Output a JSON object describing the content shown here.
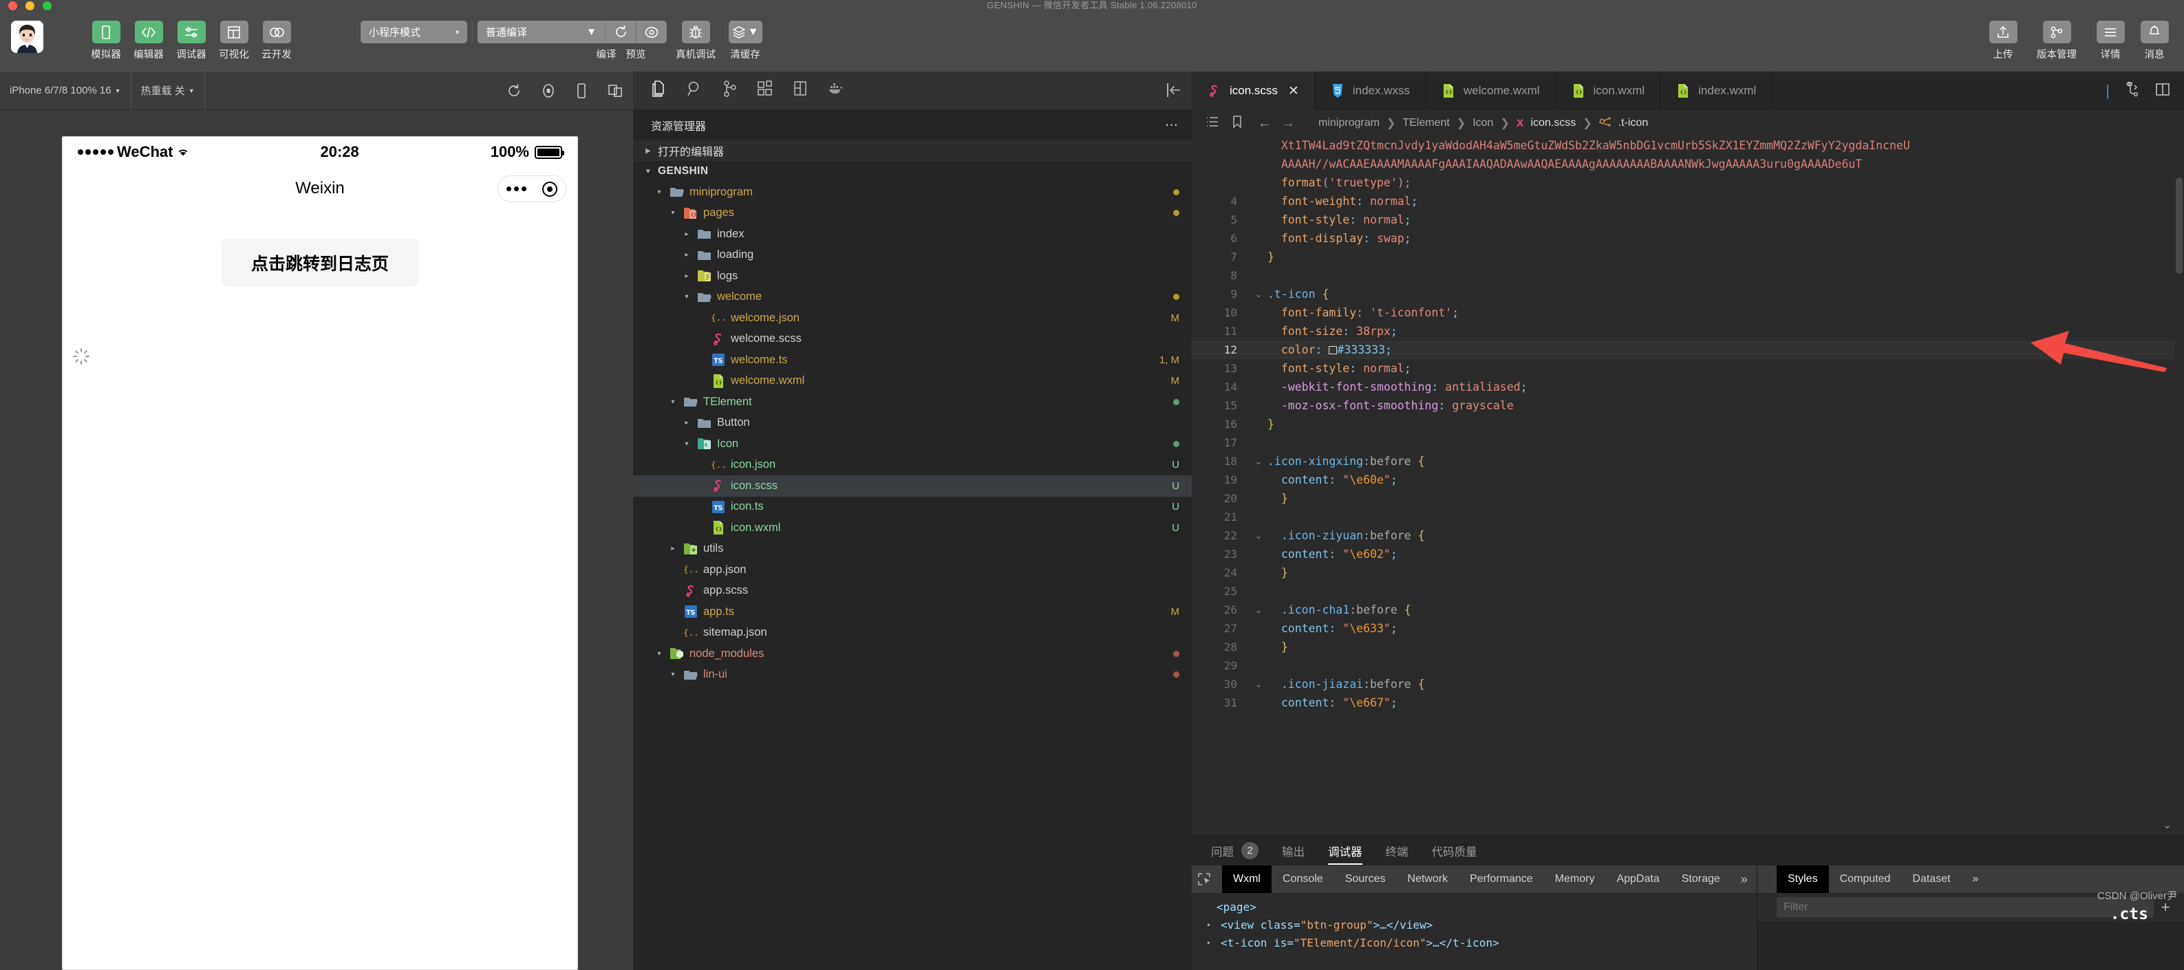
{
  "window": {
    "title": "GENSHIN — 微信开发者工具 Stable 1.06.2208010",
    "traffic": [
      "#ff5f57",
      "#febc2e",
      "#28c840"
    ]
  },
  "toolbar": {
    "left_buttons": [
      {
        "label": "模拟器",
        "icon": "phone-icon",
        "active": true
      },
      {
        "label": "编辑器",
        "icon": "code-icon",
        "active": true
      },
      {
        "label": "调试器",
        "icon": "sliders-icon",
        "active": true
      },
      {
        "label": "可视化",
        "icon": "layout-icon",
        "active": false
      },
      {
        "label": "云开发",
        "icon": "cloud-icon",
        "active": false
      }
    ],
    "mode_select": "小程序模式",
    "compile_select": "普通编译",
    "compile_label": "编译",
    "preview_label": "预览",
    "realdebug_label": "真机调试",
    "clearcache_label": "清缓存",
    "right_buttons": [
      {
        "label": "上传",
        "icon": "upload-icon"
      },
      {
        "label": "版本管理",
        "icon": "branch-icon"
      },
      {
        "label": "详情",
        "icon": "hamburger-icon"
      },
      {
        "label": "消息",
        "icon": "bell-icon"
      }
    ]
  },
  "simulator": {
    "device": "iPhone 6/7/8 100% 16",
    "hotreload": "热重载 关",
    "icons": [
      "refresh-icon",
      "record-icon",
      "device-icon",
      "multiscreen-icon"
    ],
    "phone": {
      "carrier": "WeChat",
      "time": "20:28",
      "battery_percent": "100%",
      "nav_title": "Weixin",
      "button_label": "点击跳转到日志页"
    }
  },
  "explorer": {
    "activity_icons": [
      "files-icon",
      "search-icon",
      "source-control-icon",
      "extensions-icon",
      "debug-icon",
      "docker-icon"
    ],
    "collapse_icon": "collapse-sidebar-icon",
    "title": "资源管理器",
    "more_icon": "ellipsis-icon",
    "open_editors": "打开的编辑器",
    "root": "GENSHIN",
    "tree": [
      {
        "name": "miniprogram",
        "indent": 1,
        "type": "folder-open",
        "color": "#cda84a",
        "twisty": "▾",
        "dot": "#b59a2f",
        "badge": ""
      },
      {
        "name": "pages",
        "indent": 2,
        "type": "folder-pages",
        "color": "#cda84a",
        "twisty": "▾",
        "dot": "#b59a2f",
        "badge": ""
      },
      {
        "name": "index",
        "indent": 3,
        "type": "folder",
        "color": "#cfcfcf",
        "twisty": "▸",
        "dot": "",
        "badge": ""
      },
      {
        "name": "loading",
        "indent": 3,
        "type": "folder",
        "color": "#cfcfcf",
        "twisty": "▸",
        "dot": "",
        "badge": ""
      },
      {
        "name": "logs",
        "indent": 3,
        "type": "folder-logs",
        "color": "#cfcfcf",
        "twisty": "▸",
        "dot": "",
        "badge": ""
      },
      {
        "name": "welcome",
        "indent": 3,
        "type": "folder-open",
        "color": "#cda84a",
        "twisty": "▾",
        "dot": "#b59a2f",
        "badge": ""
      },
      {
        "name": "welcome.json",
        "indent": 4,
        "type": "json",
        "color": "#cda84a",
        "twisty": "",
        "dot": "",
        "badge": "M",
        "badge_color": "#cda84a"
      },
      {
        "name": "welcome.scss",
        "indent": 4,
        "type": "scss",
        "color": "#cfcfcf",
        "twisty": "",
        "dot": "",
        "badge": ""
      },
      {
        "name": "welcome.ts",
        "indent": 4,
        "type": "ts",
        "color": "#cda84a",
        "twisty": "",
        "dot": "",
        "badge": "1, M",
        "badge_color": "#cda84a"
      },
      {
        "name": "welcome.wxml",
        "indent": 4,
        "type": "wxml",
        "color": "#cda84a",
        "twisty": "",
        "dot": "",
        "badge": "M",
        "badge_color": "#cda84a"
      },
      {
        "name": "TElement",
        "indent": 2,
        "type": "folder-open",
        "color": "#8ed6a0",
        "twisty": "▾",
        "dot": "#5fa06f",
        "badge": ""
      },
      {
        "name": "Button",
        "indent": 3,
        "type": "folder",
        "color": "#cfcfcf",
        "twisty": "▸",
        "dot": "",
        "badge": ""
      },
      {
        "name": "Icon",
        "indent": 3,
        "type": "folder-icon",
        "color": "#8ed6a0",
        "twisty": "▾",
        "dot": "#5fa06f",
        "badge": ""
      },
      {
        "name": "icon.json",
        "indent": 4,
        "type": "json",
        "color": "#8ed6a0",
        "twisty": "",
        "dot": "",
        "badge": "U",
        "badge_color": "#8ed6a0"
      },
      {
        "name": "icon.scss",
        "indent": 4,
        "type": "scss",
        "color": "#8ed6a0",
        "twisty": "",
        "dot": "",
        "badge": "U",
        "badge_color": "#8ed6a0",
        "selected": true
      },
      {
        "name": "icon.ts",
        "indent": 4,
        "type": "ts",
        "color": "#8ed6a0",
        "twisty": "",
        "dot": "",
        "badge": "U",
        "badge_color": "#8ed6a0"
      },
      {
        "name": "icon.wxml",
        "indent": 4,
        "type": "wxml",
        "color": "#8ed6a0",
        "twisty": "",
        "dot": "",
        "badge": "U",
        "badge_color": "#8ed6a0"
      },
      {
        "name": "utils",
        "indent": 2,
        "type": "folder-utils",
        "color": "#cfcfcf",
        "twisty": "▸",
        "dot": "",
        "badge": ""
      },
      {
        "name": "app.json",
        "indent": 2,
        "type": "json",
        "color": "#cfcfcf",
        "twisty": "",
        "dot": "",
        "badge": ""
      },
      {
        "name": "app.scss",
        "indent": 2,
        "type": "scss",
        "color": "#cfcfcf",
        "twisty": "",
        "dot": "",
        "badge": ""
      },
      {
        "name": "app.ts",
        "indent": 2,
        "type": "ts",
        "color": "#cda84a",
        "twisty": "",
        "dot": "",
        "badge": "M",
        "badge_color": "#cda84a"
      },
      {
        "name": "sitemap.json",
        "indent": 2,
        "type": "json",
        "color": "#cfcfcf",
        "twisty": "",
        "dot": "",
        "badge": ""
      },
      {
        "name": "node_modules",
        "indent": 1,
        "type": "folder-node",
        "color": "#d98a7a",
        "twisty": "▾",
        "dot": "#a9574a",
        "badge": ""
      },
      {
        "name": "lin-ui",
        "indent": 2,
        "type": "folder-open",
        "color": "#d98a7a",
        "twisty": "▾",
        "dot": "#a9574a",
        "badge": ""
      }
    ]
  },
  "editor": {
    "tabs": [
      {
        "label": "icon.scss",
        "icon": "scss-icon",
        "active": true,
        "closable": true
      },
      {
        "label": "index.wxss",
        "icon": "wxss-icon",
        "active": false
      },
      {
        "label": "welcome.wxml",
        "icon": "wxml-icon",
        "active": false
      },
      {
        "label": "icon.wxml",
        "icon": "wxml-icon",
        "active": false
      },
      {
        "label": "index.wxml",
        "icon": "wxml-icon",
        "active": false
      }
    ],
    "tab_actions": [
      "split-icon",
      "layout-icon"
    ],
    "breadcrumb_icons": [
      "outline-icon",
      "bookmark-icon",
      "back-arrow-icon",
      "forward-arrow-icon"
    ],
    "breadcrumb": [
      "miniprogram",
      "TElement",
      "Icon",
      "icon.scss",
      ".t-icon"
    ],
    "lines": [
      {
        "num": "",
        "fold": "",
        "parts": [
          {
            "t": "  Xt1TW4Lad9tZQtmcnJvdy1yaWdodAH4aW5meGtuZWdSb2ZkaW5nbDG1vcmUrb5SkZX1EYZmmMQ2ZzWFyY2ygdaIncneU",
            "c": "k-b64"
          }
        ]
      },
      {
        "num": "",
        "fold": "",
        "parts": [
          {
            "t": "  AAAAH//wACAAEAAAAMAAAAFgAAAIAAQADAAwAAQAEAAAAgAAAAAAAABAAAANWkJwgAAAAA3uru0gAAAADe6uT",
            "c": "k-b64"
          }
        ]
      },
      {
        "num": "",
        "fold": "",
        "parts": [
          {
            "t": "  ",
            "c": ""
          },
          {
            "t": "format",
            "c": "k-fn"
          },
          {
            "t": "(",
            "c": "k-quote"
          },
          {
            "t": "'truetype'",
            "c": "k-str"
          },
          {
            "t": ")",
            "c": "k-quote"
          },
          {
            "t": ";",
            "c": "k-quote"
          }
        ]
      },
      {
        "num": "4",
        "fold": "",
        "parts": [
          {
            "t": "  ",
            "c": ""
          },
          {
            "t": "font-weight",
            "c": "k-prop"
          },
          {
            "t": ":",
            "c": "k-hex"
          },
          {
            "t": " normal",
            "c": "k-val"
          },
          {
            "t": ";",
            "c": "k-hex"
          }
        ]
      },
      {
        "num": "5",
        "fold": "",
        "parts": [
          {
            "t": "  ",
            "c": ""
          },
          {
            "t": "font-style",
            "c": "k-prop"
          },
          {
            "t": ":",
            "c": "k-hex"
          },
          {
            "t": " normal",
            "c": "k-val"
          },
          {
            "t": ";",
            "c": "k-hex"
          }
        ]
      },
      {
        "num": "6",
        "fold": "",
        "parts": [
          {
            "t": "  ",
            "c": ""
          },
          {
            "t": "font-display",
            "c": "k-prop"
          },
          {
            "t": ":",
            "c": "k-hex"
          },
          {
            "t": " swap",
            "c": "k-val"
          },
          {
            "t": ";",
            "c": "k-hex"
          }
        ]
      },
      {
        "num": "7",
        "fold": "",
        "parts": [
          {
            "t": "}",
            "c": "k-punc"
          }
        ]
      },
      {
        "num": "8",
        "fold": "",
        "parts": []
      },
      {
        "num": "9",
        "fold": "⌄",
        "parts": [
          {
            "t": ".t-icon",
            "c": "k-sel"
          },
          {
            "t": " ",
            "c": ""
          },
          {
            "t": "{",
            "c": "k-punc"
          }
        ]
      },
      {
        "num": "10",
        "fold": "",
        "parts": [
          {
            "t": "  ",
            "c": ""
          },
          {
            "t": "font-family",
            "c": "k-prop"
          },
          {
            "t": ": ",
            "c": "k-hex"
          },
          {
            "t": "'t-iconfont'",
            "c": "k-str"
          },
          {
            "t": ";",
            "c": "k-hex"
          }
        ]
      },
      {
        "num": "11",
        "fold": "",
        "parts": [
          {
            "t": "  ",
            "c": ""
          },
          {
            "t": "font-size",
            "c": "k-prop"
          },
          {
            "t": ": ",
            "c": "k-hex"
          },
          {
            "t": "38",
            "c": "k-num"
          },
          {
            "t": "rpx",
            "c": "k-val"
          },
          {
            "t": ";",
            "c": "k-hex"
          }
        ]
      },
      {
        "num": "12",
        "fold": "",
        "highlight": true,
        "swatch": "#333333",
        "parts": [
          {
            "t": "  ",
            "c": ""
          },
          {
            "t": "color",
            "c": "k-prop"
          },
          {
            "t": ": ",
            "c": "k-hex"
          },
          {
            "t": "SWATCH",
            "c": ""
          },
          {
            "t": "#333333",
            "c": "k-hex"
          },
          {
            "t": ";",
            "c": "k-hex"
          }
        ]
      },
      {
        "num": "13",
        "fold": "",
        "parts": [
          {
            "t": "  ",
            "c": ""
          },
          {
            "t": "font-style",
            "c": "k-prop"
          },
          {
            "t": ":",
            "c": "k-hex"
          },
          {
            "t": " normal",
            "c": "k-val"
          },
          {
            "t": ";",
            "c": "k-hex"
          }
        ]
      },
      {
        "num": "14",
        "fold": "",
        "parts": [
          {
            "t": "  ",
            "c": ""
          },
          {
            "t": "-webkit-font-smoothing",
            "c": "k-vendor"
          },
          {
            "t": ":",
            "c": "k-hex"
          },
          {
            "t": " antialiased",
            "c": "k-val"
          },
          {
            "t": ";",
            "c": "k-hex"
          }
        ]
      },
      {
        "num": "15",
        "fold": "",
        "parts": [
          {
            "t": "  ",
            "c": ""
          },
          {
            "t": "-moz-osx-font-smoothing",
            "c": "k-vendor"
          },
          {
            "t": ":",
            "c": "k-hex"
          },
          {
            "t": " grayscale",
            "c": "k-val"
          }
        ]
      },
      {
        "num": "16",
        "fold": "",
        "parts": [
          {
            "t": "}",
            "c": "k-punc"
          }
        ]
      },
      {
        "num": "17",
        "fold": "",
        "parts": []
      },
      {
        "num": "18",
        "fold": "⌄",
        "parts": [
          {
            "t": ".icon-xingxing",
            "c": "k-sel"
          },
          {
            "t": ":before",
            "c": "k-pseudo"
          },
          {
            "t": " ",
            "c": ""
          },
          {
            "t": "{",
            "c": "k-punc"
          }
        ]
      },
      {
        "num": "19",
        "fold": "",
        "parts": [
          {
            "t": "  ",
            "c": ""
          },
          {
            "t": "content",
            "c": "k-hex"
          },
          {
            "t": ": ",
            "c": "k-hex"
          },
          {
            "t": "\"",
            "c": "k-val"
          },
          {
            "t": "\\e60e",
            "c": "k-esc"
          },
          {
            "t": "\"",
            "c": "k-val"
          },
          {
            "t": ";",
            "c": "k-hex"
          }
        ]
      },
      {
        "num": "20",
        "fold": "",
        "parts": [
          {
            "t": "  }",
            "c": "k-punc"
          }
        ]
      },
      {
        "num": "21",
        "fold": "",
        "parts": []
      },
      {
        "num": "22",
        "fold": "⌄",
        "parts": [
          {
            "t": "  .icon-ziyuan",
            "c": "k-sel"
          },
          {
            "t": ":before",
            "c": "k-pseudo"
          },
          {
            "t": " ",
            "c": ""
          },
          {
            "t": "{",
            "c": "k-punc"
          }
        ]
      },
      {
        "num": "23",
        "fold": "",
        "parts": [
          {
            "t": "  ",
            "c": ""
          },
          {
            "t": "content",
            "c": "k-hex"
          },
          {
            "t": ": ",
            "c": "k-hex"
          },
          {
            "t": "\"",
            "c": "k-val"
          },
          {
            "t": "\\e602",
            "c": "k-esc"
          },
          {
            "t": "\"",
            "c": "k-val"
          },
          {
            "t": ";",
            "c": "k-hex"
          }
        ]
      },
      {
        "num": "24",
        "fold": "",
        "parts": [
          {
            "t": "  }",
            "c": "k-punc"
          }
        ]
      },
      {
        "num": "25",
        "fold": "",
        "parts": []
      },
      {
        "num": "26",
        "fold": "⌄",
        "parts": [
          {
            "t": "  .icon-cha1",
            "c": "k-sel"
          },
          {
            "t": ":before",
            "c": "k-pseudo"
          },
          {
            "t": " ",
            "c": ""
          },
          {
            "t": "{",
            "c": "k-punc"
          }
        ]
      },
      {
        "num": "27",
        "fold": "",
        "parts": [
          {
            "t": "  ",
            "c": ""
          },
          {
            "t": "content",
            "c": "k-hex"
          },
          {
            "t": ": ",
            "c": "k-hex"
          },
          {
            "t": "\"",
            "c": "k-val"
          },
          {
            "t": "\\e633",
            "c": "k-esc"
          },
          {
            "t": "\"",
            "c": "k-val"
          },
          {
            "t": ";",
            "c": "k-hex"
          }
        ]
      },
      {
        "num": "28",
        "fold": "",
        "parts": [
          {
            "t": "  }",
            "c": "k-punc"
          }
        ]
      },
      {
        "num": "29",
        "fold": "",
        "parts": []
      },
      {
        "num": "30",
        "fold": "⌄",
        "parts": [
          {
            "t": "  .icon-jiazai",
            "c": "k-sel"
          },
          {
            "t": ":before",
            "c": "k-pseudo"
          },
          {
            "t": " ",
            "c": ""
          },
          {
            "t": "{",
            "c": "k-punc"
          }
        ]
      },
      {
        "num": "31",
        "fold": "",
        "parts": [
          {
            "t": "  ",
            "c": ""
          },
          {
            "t": "content",
            "c": "k-hex"
          },
          {
            "t": ": ",
            "c": "k-hex"
          },
          {
            "t": "\"",
            "c": "k-val"
          },
          {
            "t": "\\e667",
            "c": "k-esc"
          },
          {
            "t": "\"",
            "c": "k-val"
          },
          {
            "t": ";",
            "c": "k-hex"
          }
        ]
      }
    ],
    "annotation_arrow_color": "#f04a42"
  },
  "bottom": {
    "tabs": [
      {
        "label": "问题",
        "badge": "2",
        "active": false
      },
      {
        "label": "输出",
        "badge": "",
        "active": false
      },
      {
        "label": "调试器",
        "badge": "",
        "active": true
      },
      {
        "label": "终端",
        "badge": "",
        "active": false
      },
      {
        "label": "代码质量",
        "badge": "",
        "active": false
      }
    ],
    "devtools": {
      "inspect_icon": "inspect-icon",
      "tabs": [
        "Wxml",
        "Console",
        "Sources",
        "Network",
        "Performance",
        "Memory",
        "AppData",
        "Storage"
      ],
      "active_tab": "Wxml",
      "overflow": "»",
      "settings_icon": "gear-icon",
      "dom": [
        {
          "indent": 0,
          "twisty": "",
          "text": "<page>"
        },
        {
          "indent": 1,
          "twisty": "▸",
          "pre": "<view class=",
          "attr": "\"btn-group\"",
          "post": ">…</view>"
        },
        {
          "indent": 1,
          "twisty": "▸",
          "pre": "<t-icon is=",
          "attr": "\"TElement/Icon/icon\"",
          "post": ">…</t-icon>"
        }
      ],
      "side_tabs": [
        "Styles",
        "Computed",
        "Dataset"
      ],
      "side_active": "Styles",
      "side_overflow": "»",
      "filter_placeholder": "Filter",
      "plus_icon": "plus-icon",
      "side_label": ".cts"
    }
  },
  "watermark": "CSDN @Oliver尹"
}
